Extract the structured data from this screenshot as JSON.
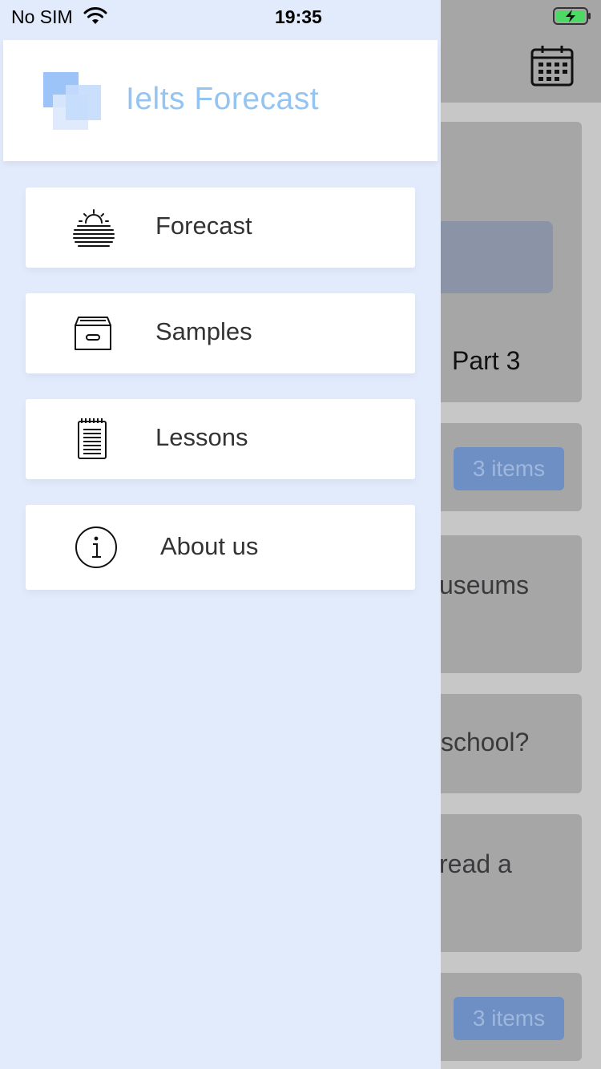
{
  "status_bar": {
    "carrier": "No SIM",
    "time": "19:35"
  },
  "drawer": {
    "app_title": "Ielts Forecast",
    "items": [
      {
        "label": "Forecast",
        "icon": "sunrise-icon"
      },
      {
        "label": "Samples",
        "icon": "archive-box-icon"
      },
      {
        "label": "Lessons",
        "icon": "notepad-icon"
      },
      {
        "label": "About us",
        "icon": "info-icon"
      }
    ]
  },
  "background": {
    "part_label": "Part 3",
    "badge_1": "3 items",
    "snippet_1": "useums",
    "snippet_2": "school?",
    "snippet_3": "read a",
    "badge_2": "3 items"
  },
  "colors": {
    "drawer_bg": "#e2ebfc",
    "title_blue": "#94c4f2",
    "overlay_gray": "#a6a6a7",
    "badge_blue": "#6d8fc4",
    "battery_green": "#4cd964"
  }
}
